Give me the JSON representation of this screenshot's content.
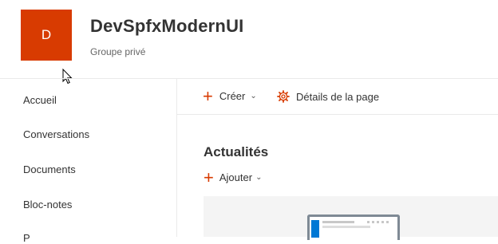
{
  "site": {
    "logo_letter": "D",
    "title": "DevSpfxModernUI",
    "subtitle": "Groupe privé",
    "logo_color": "#d83b01"
  },
  "nav": {
    "items": [
      {
        "label": "Accueil"
      },
      {
        "label": "Conversations"
      },
      {
        "label": "Documents"
      },
      {
        "label": "Bloc-notes"
      },
      {
        "label": "P"
      }
    ]
  },
  "command_bar": {
    "create_label": "Créer",
    "page_details_label": "Détails de la page",
    "icons": [
      "plus-icon",
      "chevron-down-icon",
      "gear-icon"
    ]
  },
  "news": {
    "title": "Actualités",
    "add_label": "Ajouter"
  },
  "colors": {
    "accent": "#d83b01",
    "mock_blue": "#0078d4"
  }
}
